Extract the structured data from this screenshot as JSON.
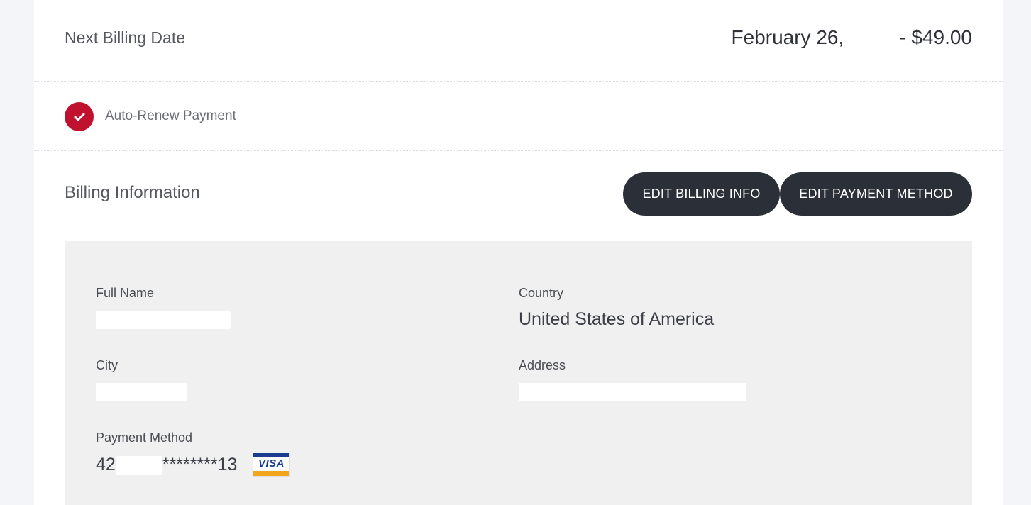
{
  "billing_date": {
    "label": "Next Billing Date",
    "date": "February 26,",
    "amount": "- $49.00"
  },
  "auto_renew": {
    "label": "Auto-Renew Payment",
    "checked": true,
    "color": "#c0122f"
  },
  "billing_info": {
    "title": "Billing Information",
    "edit_billing_label": "EDIT BILLING INFO",
    "edit_payment_label": "EDIT PAYMENT METHOD"
  },
  "fields": {
    "full_name": {
      "label": "Full Name",
      "value": ""
    },
    "country": {
      "label": "Country",
      "value": "United States of America"
    },
    "city": {
      "label": "City",
      "value": ""
    },
    "address": {
      "label": "Address",
      "value": ""
    },
    "payment_method": {
      "label": "Payment Method",
      "prefix": "42",
      "suffix": "********13",
      "card_brand": "VISA"
    }
  },
  "icons": {
    "auto_renew": "check-icon",
    "card": "visa-card-icon"
  }
}
